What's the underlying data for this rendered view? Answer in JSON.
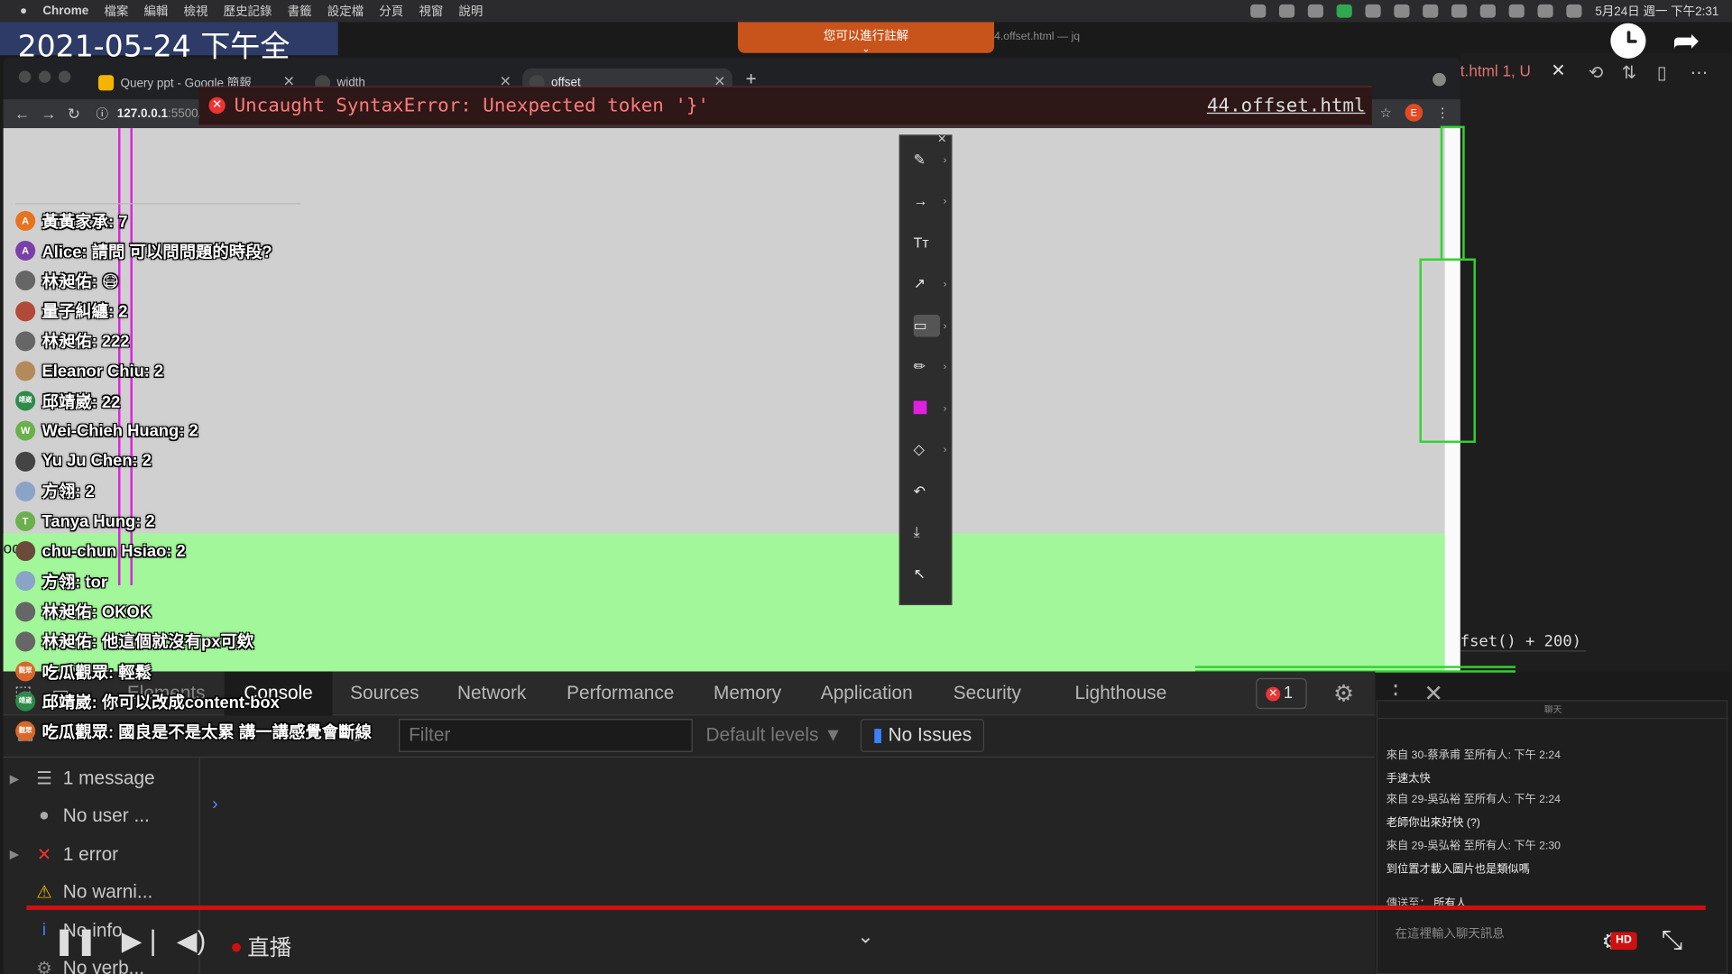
{
  "menubar": {
    "items": [
      "Chrome",
      "檔案",
      "編輯",
      "檢視",
      "歷史記錄",
      "書籤",
      "設定檔",
      "分頁",
      "視窗",
      "說明"
    ],
    "datetime": "5月24日 週一 下午2:31"
  },
  "stream": {
    "date_overlay": "2021-05-24 下午全",
    "notice": "您可以進行註解",
    "vscode_window_title": "4.offset.html — jq",
    "live_label": "直播",
    "hd_label": "HD"
  },
  "vscode": {
    "tab_label": "t.html 1, U",
    "code_fragment": "fset() + 200)"
  },
  "chrome": {
    "tabs": [
      {
        "label": "Query ppt - Google 簡報",
        "favicon_color": "#f4b400"
      },
      {
        "label": "width",
        "favicon_color": "#555555"
      },
      {
        "label": "offset",
        "favicon_color": "#555555"
      }
    ],
    "url": "127.0.0.1",
    "url_path": ":5500/44.offset.html",
    "profile_letter": "E"
  },
  "page": {
    "partial_text": "oo"
  },
  "annotation_tools": [
    "pen-tool",
    "arrow-tool",
    "text-tool",
    "line-arrow-tool",
    "rectangle-tool",
    "pencil-tool",
    "color-tool",
    "eraser-tool",
    "undo-tool",
    "save-tool",
    "pointer-tool"
  ],
  "annotation_color": "#e020e0",
  "chat_overlay": [
    {
      "text": "黃黃家承: 7",
      "avatar_color": "#e8731f",
      "initial": "A"
    },
    {
      "text": "Alice: 請問 可以問問題的時段?",
      "avatar_color": "#7b3fa8",
      "initial": "A"
    },
    {
      "text": "林昶佑: 😷",
      "avatar_color": "#666666",
      "initial": ""
    },
    {
      "text": "量子糾纏: 2",
      "avatar_color": "#b24a3a",
      "initial": ""
    },
    {
      "text": "林昶佑: 222",
      "avatar_color": "#666666",
      "initial": ""
    },
    {
      "text": "Eleanor Chiu: 2",
      "avatar_color": "#b58a5a",
      "initial": ""
    },
    {
      "text": "邱靖崴: 22",
      "avatar_color": "#2f8a4a",
      "initial": "靖崴"
    },
    {
      "text": "Wei-Chieh Huang: 2",
      "avatar_color": "#6ab04c",
      "initial": "W"
    },
    {
      "text": "Yu Ju Chen: 2",
      "avatar_color": "#444444",
      "initial": ""
    },
    {
      "text": "方翎: 2",
      "avatar_color": "#8aa4c8",
      "initial": ""
    },
    {
      "text": "Tanya Hung: 2",
      "avatar_color": "#6ab04c",
      "initial": "T"
    },
    {
      "text": "chu-chun Hsiao: 2",
      "avatar_color": "#6a4a3a",
      "initial": ""
    },
    {
      "text": "方翎: tor",
      "avatar_color": "#8aa4c8",
      "initial": ""
    },
    {
      "text": "林昶佑: OKOK",
      "avatar_color": "#666666",
      "initial": ""
    },
    {
      "text": "林昶佑: 他這個就沒有px可欸",
      "avatar_color": "#666666",
      "initial": ""
    },
    {
      "text": "吃瓜觀眾: 輕鬆",
      "avatar_color": "#d9682a",
      "initial": "觀眾"
    },
    {
      "text": "邱靖崴: 你可以改成content-box",
      "avatar_color": "#2f8a4a",
      "initial": "靖崴"
    },
    {
      "text": "吃瓜觀眾: 國良是不是太累 講一講感覺會斷線",
      "avatar_color": "#d9682a",
      "initial": "觀眾"
    }
  ],
  "devtools": {
    "tabs": [
      "Elements",
      "Console",
      "Sources",
      "Network",
      "Performance",
      "Memory",
      "Application",
      "Security",
      "Lighthouse"
    ],
    "error_count": "1",
    "filter_placeholder": "Filter",
    "levels": "Default levels ▼",
    "no_issues": "No Issues",
    "sidebar": [
      {
        "label": "1 message",
        "icon": "list-icon",
        "expandable": true
      },
      {
        "label": "No user ...",
        "icon": "user-icon",
        "expandable": false
      },
      {
        "label": "1 error",
        "icon": "error-icon",
        "expandable": true
      },
      {
        "label": "No warni...",
        "icon": "warning-icon",
        "expandable": false
      },
      {
        "label": "No info",
        "icon": "info-icon",
        "expandable": false
      },
      {
        "label": "No verb...",
        "icon": "verbose-icon",
        "expandable": false
      }
    ],
    "error_message": "Uncaught SyntaxError: Unexpected token '}'",
    "error_source": "44.offset.html"
  },
  "zoom_chat": {
    "title": "聊天",
    "messages": [
      {
        "header": "來自 30-蔡承甫 至所有人:  下午 2:24",
        "body": "手速太快"
      },
      {
        "header": "來自 29-吳弘裕 至所有人:  下午 2:24",
        "body": "老師你出來好快 (?)"
      },
      {
        "header": "來自 29-吳弘裕 至所有人:  下午 2:30",
        "body": "到位置才載入圖片也是類似嗎"
      }
    ],
    "send_to_label": "傳送至：",
    "send_to_value": "所有人",
    "input_placeholder": "在這裡輸入聊天訊息"
  }
}
